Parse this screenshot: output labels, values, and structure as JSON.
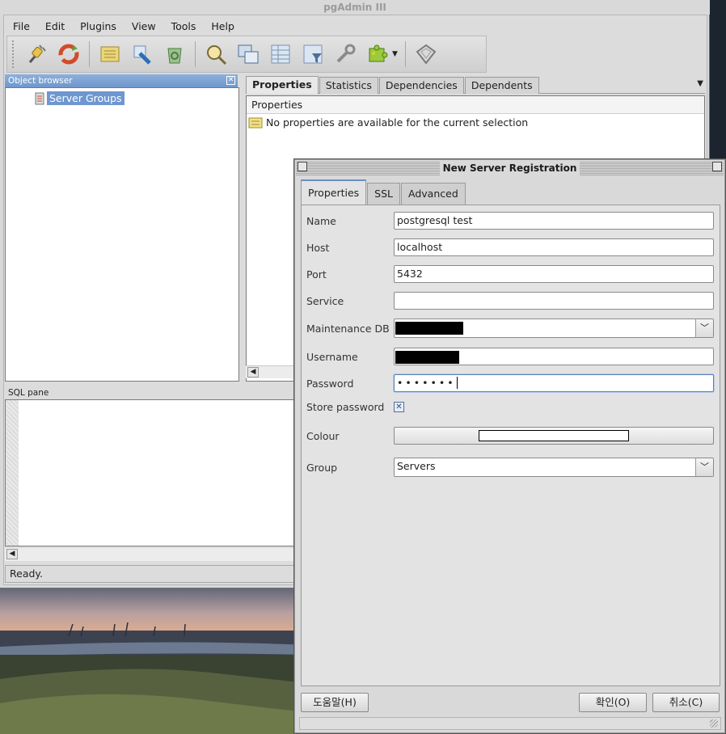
{
  "app": {
    "title": "pgAdmin III",
    "menu": [
      "File",
      "Edit",
      "Plugins",
      "View",
      "Tools",
      "Help"
    ],
    "toolbar_icons": [
      "plug-icon",
      "refresh-icon",
      "properties-icon",
      "create-icon",
      "delete-icon",
      "search-icon",
      "query-tool-icon",
      "view-data-icon",
      "filtered-data-icon",
      "maintenance-icon",
      "plugins-icon",
      "help-icon"
    ]
  },
  "object_browser": {
    "title": "Object browser",
    "tree": [
      {
        "label": "Server Groups"
      }
    ]
  },
  "properties_panel": {
    "tabs": [
      "Properties",
      "Statistics",
      "Dependencies",
      "Dependents"
    ],
    "header": "Properties",
    "message": "No properties are available for the current selection"
  },
  "sql_pane": {
    "title": "SQL pane"
  },
  "status_bar": {
    "text": "Ready."
  },
  "dialog": {
    "title": "New Server Registration",
    "tabs": [
      "Properties",
      "SSL",
      "Advanced"
    ],
    "fields": {
      "name": {
        "label": "Name",
        "value": "postgresql test"
      },
      "host": {
        "label": "Host",
        "value": "localhost"
      },
      "port": {
        "label": "Port",
        "value": "5432"
      },
      "service": {
        "label": "Service",
        "value": ""
      },
      "maintenance_db": {
        "label": "Maintenance DB",
        "value": ""
      },
      "username": {
        "label": "Username",
        "value": ""
      },
      "password": {
        "label": "Password",
        "value": "•••••••"
      },
      "store_password": {
        "label": "Store password",
        "checked": true
      },
      "colour": {
        "label": "Colour",
        "value_hex": "#ffffff"
      },
      "group": {
        "label": "Group",
        "value": "Servers"
      }
    },
    "buttons": {
      "help": "도움말(H)",
      "ok": "확인(O)",
      "cancel": "취소(C)"
    }
  },
  "colors": {
    "selection": "#6e97cf",
    "panel_header": "#7aa1d3"
  }
}
